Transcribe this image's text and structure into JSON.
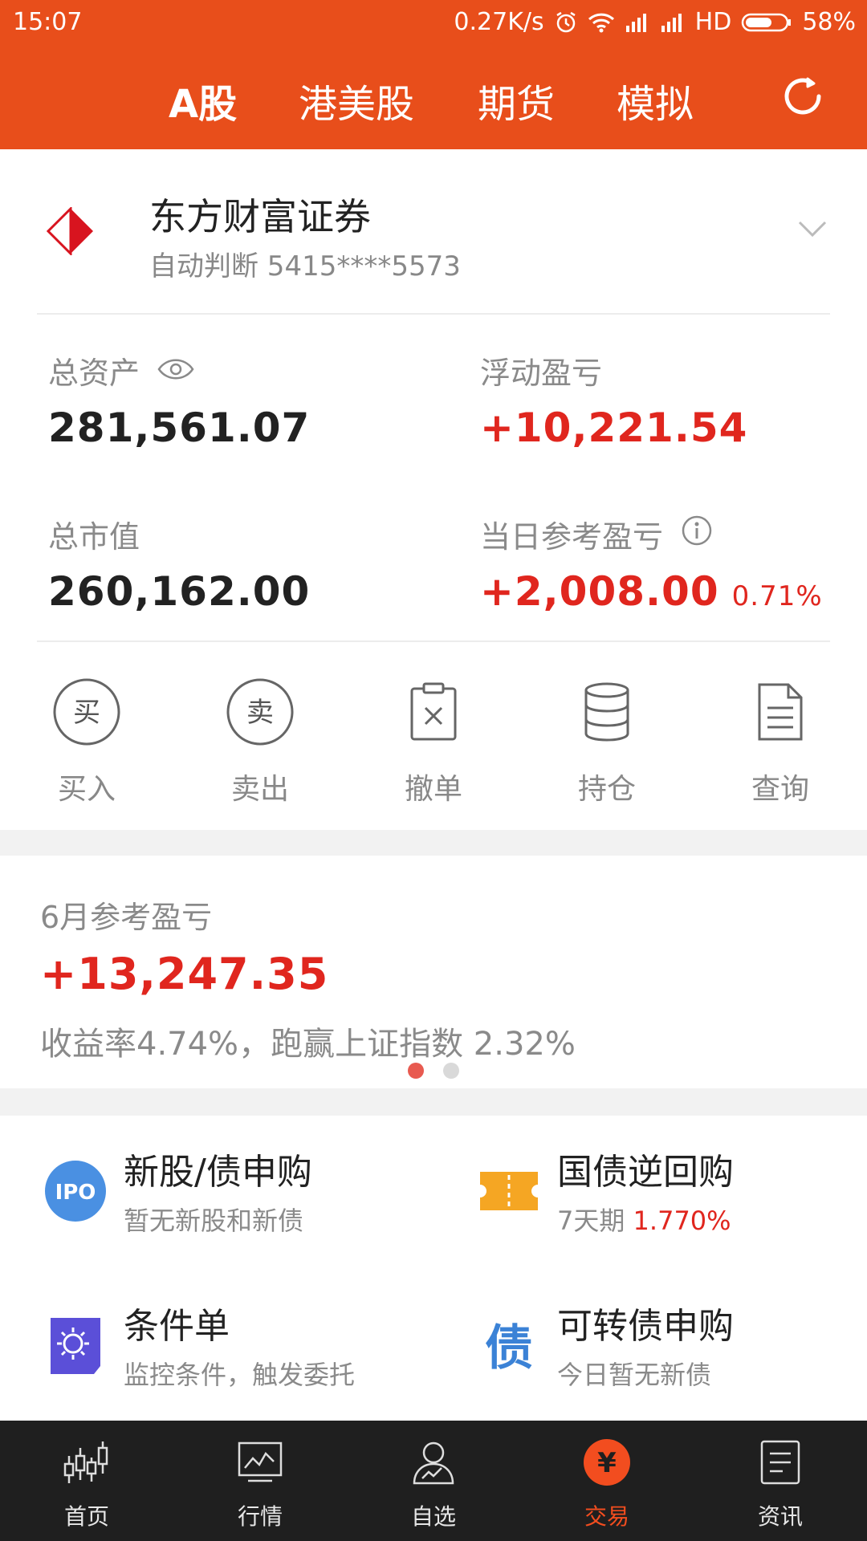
{
  "status_bar": {
    "time": "15:07",
    "speed": "0.27K/s",
    "network": "HD",
    "battery": "58%"
  },
  "top_tabs": [
    {
      "label": "A股",
      "active": true
    },
    {
      "label": "港美股",
      "active": false
    },
    {
      "label": "期货",
      "active": false
    },
    {
      "label": "模拟",
      "active": false
    }
  ],
  "account": {
    "broker_name": "东方财富证券",
    "account_line": "自动判断 5415****5573"
  },
  "stats": {
    "total_assets_label": "总资产",
    "total_assets_value": "281,561.07",
    "floating_pl_label": "浮动盈亏",
    "floating_pl_value": "+10,221.54",
    "market_value_label": "总市值",
    "market_value_value": "260,162.00",
    "daily_pl_label": "当日参考盈亏",
    "daily_pl_value": "+2,008.00",
    "daily_pl_pct": "0.71%"
  },
  "actions": [
    {
      "label": "买入",
      "glyph": "买",
      "icon": "buy-icon"
    },
    {
      "label": "卖出",
      "glyph": "卖",
      "icon": "sell-icon"
    },
    {
      "label": "撤单",
      "icon": "cancel-order-icon"
    },
    {
      "label": "持仓",
      "icon": "holdings-icon"
    },
    {
      "label": "查询",
      "icon": "query-icon"
    }
  ],
  "monthly": {
    "label": "6月参考盈亏",
    "value": "+13,247.35",
    "desc": "收益率4.74%，跑赢上证指数 2.32%",
    "pages": 2,
    "active_page": 1
  },
  "services": [
    {
      "title": "新股/债申购",
      "sub": "暂无新股和新债",
      "icon": "ipo-icon",
      "icon_text": "IPO"
    },
    {
      "title": "国债逆回购",
      "sub_prefix": "7天期 ",
      "sub_value": "1.770%",
      "icon": "ticket-icon"
    },
    {
      "title": "条件单",
      "sub": "监控条件，触发委托",
      "icon": "condition-order-icon"
    },
    {
      "title": "可转债申购",
      "sub": "今日暂无新债",
      "icon": "bond-icon",
      "icon_text": "债"
    }
  ],
  "bottom_nav": [
    {
      "label": "首页",
      "icon": "home-candlestick-icon",
      "active": false
    },
    {
      "label": "行情",
      "icon": "market-chart-icon",
      "active": false
    },
    {
      "label": "自选",
      "icon": "watchlist-user-icon",
      "active": false
    },
    {
      "label": "交易",
      "icon": "trade-yen-icon",
      "glyph": "¥",
      "active": true
    },
    {
      "label": "资讯",
      "icon": "news-icon",
      "active": false
    }
  ],
  "colors": {
    "brand": "#e84e1b",
    "gain": "#e0261e",
    "nav_bg": "#1f1f1f",
    "nav_active": "#f24d1f",
    "ipo_blue": "#4a90e2",
    "ticket_orange": "#f5a623",
    "condition_purple": "#5b4fd8"
  }
}
